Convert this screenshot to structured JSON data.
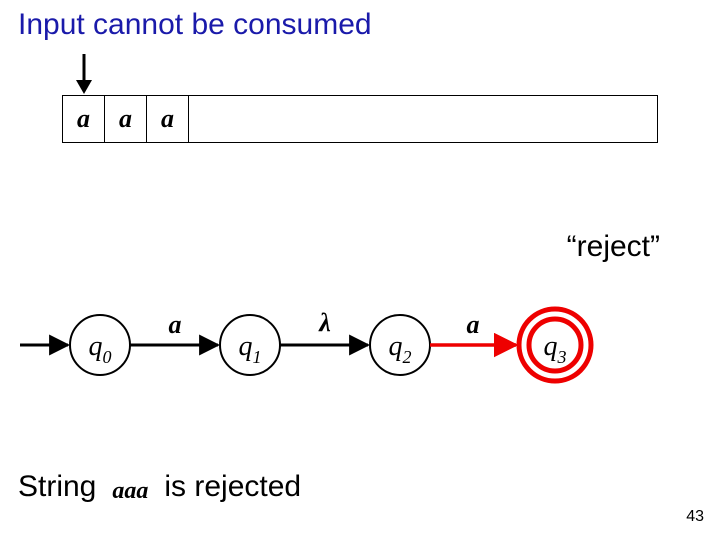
{
  "title": "Input cannot be consumed",
  "tape": {
    "cells": [
      "a",
      "a",
      "a"
    ],
    "head_index": 0
  },
  "reject_label": "“reject”",
  "automaton": {
    "states": [
      {
        "name": "q",
        "sub": "0",
        "accepting": false
      },
      {
        "name": "q",
        "sub": "1",
        "accepting": false
      },
      {
        "name": "q",
        "sub": "2",
        "accepting": false
      },
      {
        "name": "q",
        "sub": "3",
        "accepting": true,
        "highlight": true
      }
    ],
    "transitions": [
      {
        "label": "a"
      },
      {
        "label": "λ"
      },
      {
        "label": "a"
      }
    ]
  },
  "footer": {
    "left": "String",
    "mid": "aaa",
    "right": "is rejected"
  },
  "pagenum": "43"
}
